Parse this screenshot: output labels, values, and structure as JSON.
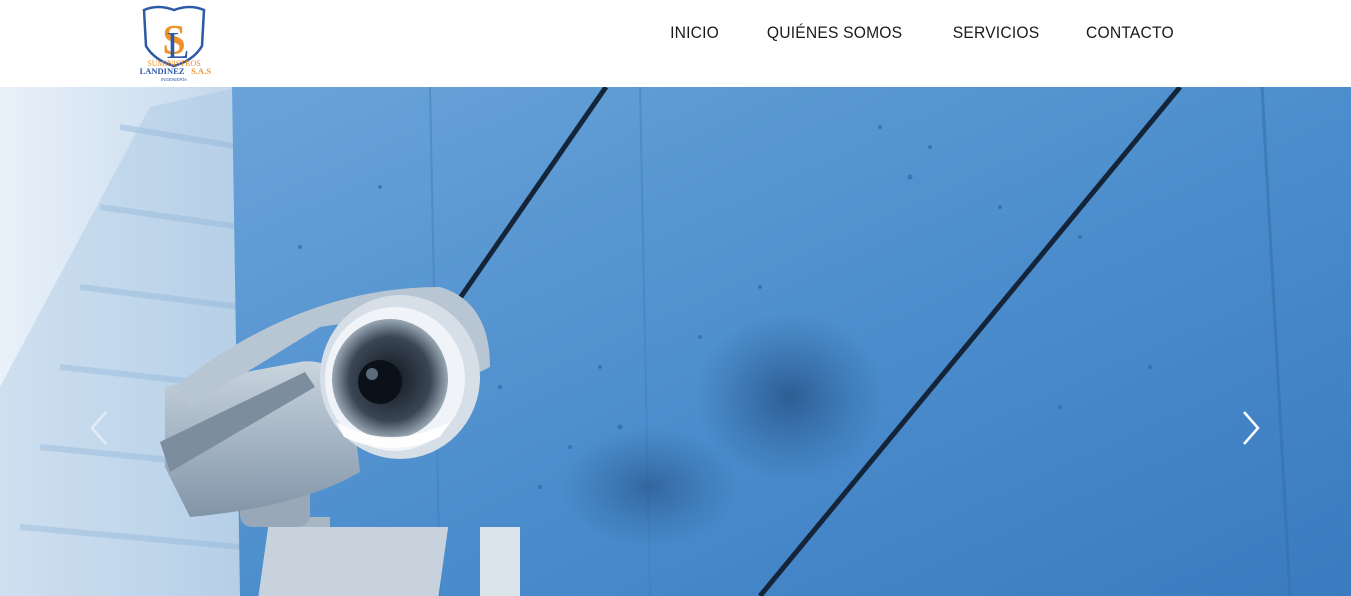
{
  "brand": {
    "logo_top_text": "SUMINISTROS",
    "logo_name": "LANDINEZ",
    "logo_suffix": "S.A.S",
    "logo_sub": "INGENIERÍA",
    "logo_monogram_s": "S",
    "logo_monogram_l": "L",
    "colors": {
      "orange": "#f0922b",
      "blue": "#2d5aa8"
    }
  },
  "nav": {
    "items": [
      {
        "label": "INICIO"
      },
      {
        "label": "QUIÉNES SOMOS"
      },
      {
        "label": "SERVICIOS"
      },
      {
        "label": "CONTACTO"
      }
    ]
  },
  "slider": {
    "prev_icon": "chevron-left-icon",
    "next_icon": "chevron-right-icon",
    "image_subject": "security-camera",
    "accent_color": "#4b8fd0"
  }
}
